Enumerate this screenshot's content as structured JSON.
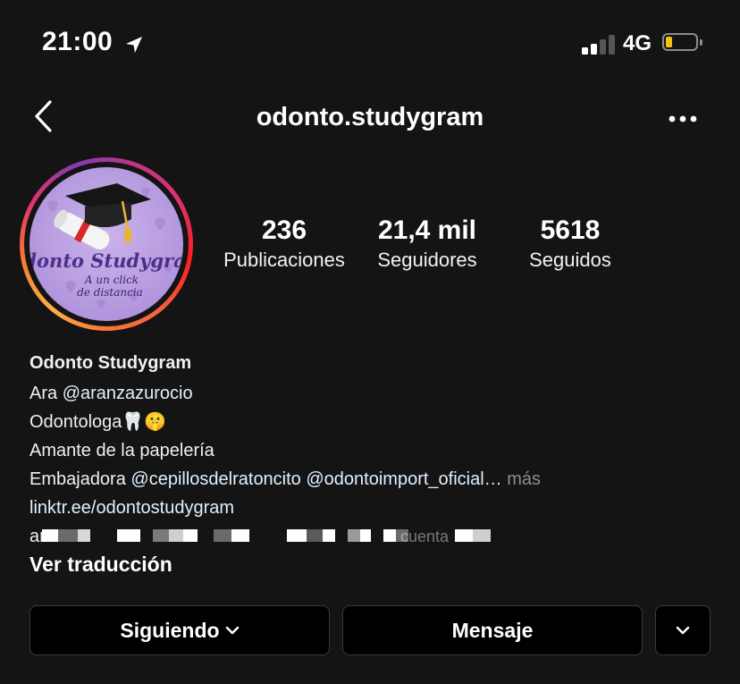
{
  "status_bar": {
    "time": "21:00",
    "network": "4G",
    "battery_level": 0.12,
    "battery_color": "#f4c20d"
  },
  "nav": {
    "title": "odonto.studygram",
    "back_icon": "chevron-left-icon",
    "more_icon": "more-horizontal-icon"
  },
  "avatar": {
    "brand_main": "Odonto Studygram",
    "brand_sub_1": "A un click",
    "brand_sub_2": "de distancia",
    "ring_colors": [
      "#833ab4",
      "#c13584",
      "#e1306c",
      "#fd1d1d",
      "#f77737",
      "#fcaf45"
    ]
  },
  "stats": [
    {
      "value": "236",
      "label": "Publicaciones"
    },
    {
      "value": "21,4 mil",
      "label": "Seguidores"
    },
    {
      "value": "5618",
      "label": "Seguidos"
    }
  ],
  "bio": {
    "name": "Odonto Studygram",
    "line1_prefix": "Ara ",
    "line1_mention": "@aranzazurocio",
    "line2": "Odontologa🦷🤫",
    "line3": "Amante de la papelería",
    "line4_prefix": "Embajadora  ",
    "line4_mention1": "@cepillosdelratoncito",
    "line4_mention2": "@odontoimport_oficial",
    "line4_ellipsis": "…",
    "more_label": "más",
    "link": "linktr.ee/odontostudygram",
    "redacted_start": "ar",
    "redacted_end": "cuenta"
  },
  "translate_label": "Ver traducción",
  "buttons": {
    "following": "Siguiendo",
    "message": "Mensaje"
  }
}
